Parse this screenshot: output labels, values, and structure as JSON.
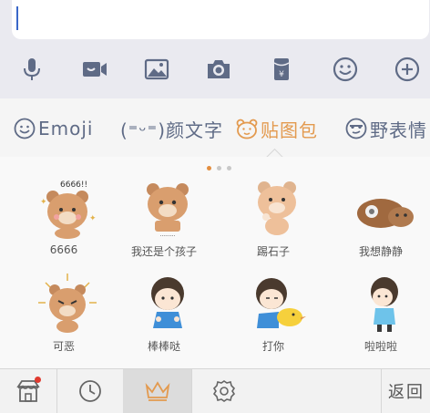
{
  "toolbar": {
    "icons": [
      "microphone-icon",
      "video-icon",
      "image-icon",
      "camera-icon",
      "red-packet-icon",
      "emoji-icon",
      "plus-icon"
    ]
  },
  "categories": [
    {
      "label": "Emoji",
      "active": false
    },
    {
      "label": "(⁼ᵕ⁼)颜文字",
      "active": false
    },
    {
      "label": "贴图包",
      "active": true
    },
    {
      "label": "野表情",
      "active": false
    }
  ],
  "pager": {
    "pages": 3,
    "current": 0
  },
  "stickers": [
    {
      "caption": "6666"
    },
    {
      "caption": "我还是个孩子"
    },
    {
      "caption": "踢石子"
    },
    {
      "caption": "我想静静"
    },
    {
      "caption": "可恶"
    },
    {
      "caption": "棒棒哒"
    },
    {
      "caption": "打你"
    },
    {
      "caption": "啦啦啦"
    }
  ],
  "bottom": {
    "tabs": [
      "store-icon",
      "recent-clock-icon",
      "crown-icon",
      "settings-icon"
    ],
    "back_label": "返回"
  },
  "colors": {
    "accent": "#e39a4f",
    "icon": "#5f6b86",
    "badge": "#e03a2f"
  }
}
